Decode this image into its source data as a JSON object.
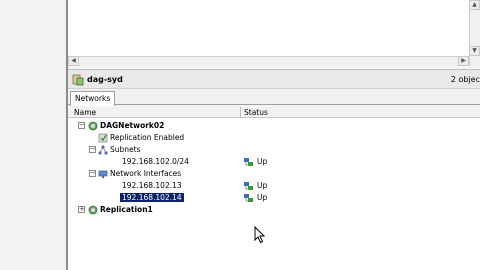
{
  "panel": {
    "title": "dag-syd",
    "count": "2 objec"
  },
  "tabs": [
    {
      "label": "Networks"
    }
  ],
  "columns": {
    "name": "Name",
    "status": "Status"
  },
  "tree": {
    "network1": {
      "label": "DAGNetwork02",
      "expanded": true,
      "replication": "Replication Enabled",
      "subnets": {
        "label": "Subnets",
        "items": [
          {
            "label": "192.168.102.0/24",
            "status": "Up"
          }
        ]
      },
      "interfaces": {
        "label": "Network Interfaces",
        "items": [
          {
            "label": "192.168.102.13",
            "status": "Up"
          },
          {
            "label": "192.168.102.14",
            "status": "Up",
            "selected": true
          }
        ]
      }
    },
    "network2": {
      "label": "Replication1",
      "expanded": false
    }
  },
  "colors": {
    "selection": "#0a246a",
    "network_icon": "#3c8a3c"
  }
}
